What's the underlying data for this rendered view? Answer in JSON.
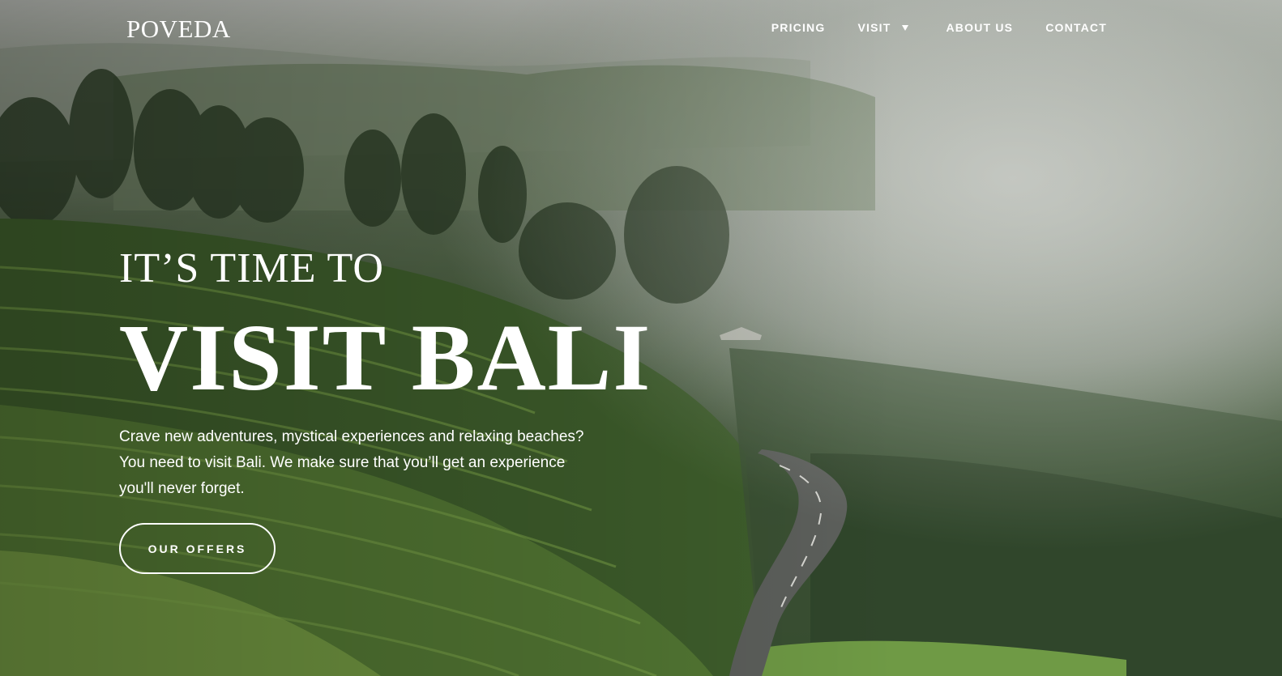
{
  "brand": {
    "logo_text": "POVEDA"
  },
  "nav": {
    "items": [
      {
        "label": "PRICING"
      },
      {
        "label": "VISIT",
        "has_dropdown": true
      },
      {
        "label": "ABOUT US"
      },
      {
        "label": "CONTACT"
      }
    ]
  },
  "hero": {
    "kicker": "IT’S TIME TO",
    "headline": "VISIT BALI",
    "lede": "Crave new adventures, mystical experiences and relaxing beaches? You need to visit Bali. We make sure that you’ll get an experience you'll never forget.",
    "cta_label": "OUR OFFERS",
    "background_image": "misty tea plantation hills with winding road"
  },
  "colors": {
    "text": "#ffffff",
    "foliage_dark": "#2f4526",
    "foliage_light": "#6f9a45",
    "fog": "#c4c7c1"
  }
}
